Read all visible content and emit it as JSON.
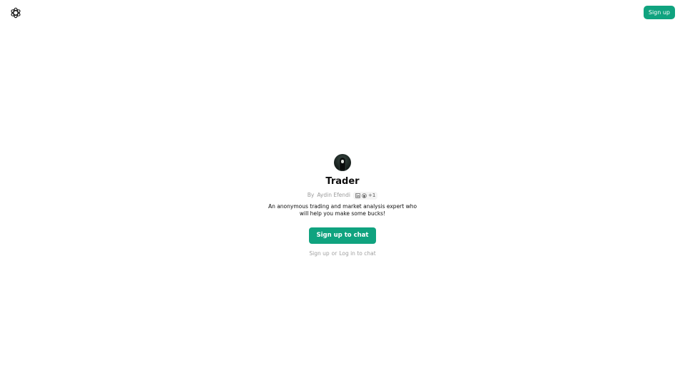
{
  "header": {
    "logo_icon": "openai-logo-icon",
    "signup_label": "Sign up"
  },
  "gpt": {
    "avatar_icon": "trader-avatar-image",
    "title": "Trader",
    "by_prefix": "By",
    "author": "Aydin Efendi",
    "social_icons": [
      "linkedin-icon",
      "github-icon"
    ],
    "social_extra": "+1",
    "description": "An anonymous trading and market analysis expert who will help you make some bucks!"
  },
  "cta": {
    "label": "Sign up to chat"
  },
  "footer": {
    "signup_link": "Sign up",
    "separator": "or",
    "login_link": "Log in to chat"
  },
  "colors": {
    "accent": "#10a37f",
    "muted_text": "#9b9b9b"
  }
}
